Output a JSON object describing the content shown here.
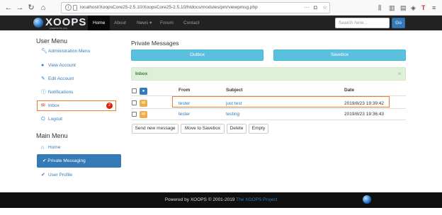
{
  "browser": {
    "url": "localhost/XoopsCore25-2.5.10/XoopsCore25-2.5.10/htdocs/modules/pm/viewpmsg.php",
    "url_more": "···"
  },
  "navbar": {
    "logo_text": "XOOPS",
    "logo_sub": "powered by you",
    "items": [
      {
        "label": "Home"
      },
      {
        "label": "About"
      },
      {
        "label": "News"
      },
      {
        "label": "Forum"
      },
      {
        "label": "Contact"
      }
    ],
    "news_caret": "▾",
    "search_placeholder": "Search here...",
    "search_button": "Go"
  },
  "user_menu": {
    "heading": "User Menu",
    "items": [
      {
        "label": "Administration Menu",
        "icon": "wrench-icon"
      },
      {
        "label": "View Account",
        "icon": "user-icon"
      },
      {
        "label": "Edit Account",
        "icon": "pencil-icon"
      },
      {
        "label": "Notifications",
        "icon": "info-icon"
      },
      {
        "label": "Inbox",
        "icon": "envelope-icon",
        "badge": "2"
      },
      {
        "label": "Logout",
        "icon": "power-icon"
      }
    ]
  },
  "main_menu": {
    "heading": "Main Menu",
    "items": [
      {
        "label": "Home",
        "icon": "home-icon"
      },
      {
        "label": "Private Messaging",
        "icon": "check-icon",
        "active": true
      },
      {
        "label": "User Profile",
        "icon": "check-icon"
      }
    ]
  },
  "pm": {
    "title": "Private Messages",
    "outbox_button": "Outbox",
    "savebox_button": "Savebox",
    "inbox_label": "Inbox",
    "close_glyph": "×",
    "columns": {
      "from": "From",
      "subject": "Subject",
      "date": "Date"
    },
    "rows": [
      {
        "from": "tester",
        "subject": "just test",
        "date": "2019/8/23 19:39:42",
        "unread": true
      },
      {
        "from": "tester",
        "subject": "testing",
        "date": "2019/8/23 19:36:43",
        "unread": true
      }
    ],
    "actions": {
      "send_new": "Send new message",
      "move_to_savebox": "Move to Savebox",
      "delete": "Delete",
      "empty": "Empty"
    }
  },
  "footer": {
    "text": "Powered by XOOPS © 2001-2019 ",
    "link": "The XOOPS Project"
  },
  "colors": {
    "primary": "#337ab7",
    "info": "#5bc0de",
    "success_bg": "#dff0d8",
    "highlight": "#ef7d30",
    "navbar": "#222222",
    "badge": "#d9230f"
  }
}
